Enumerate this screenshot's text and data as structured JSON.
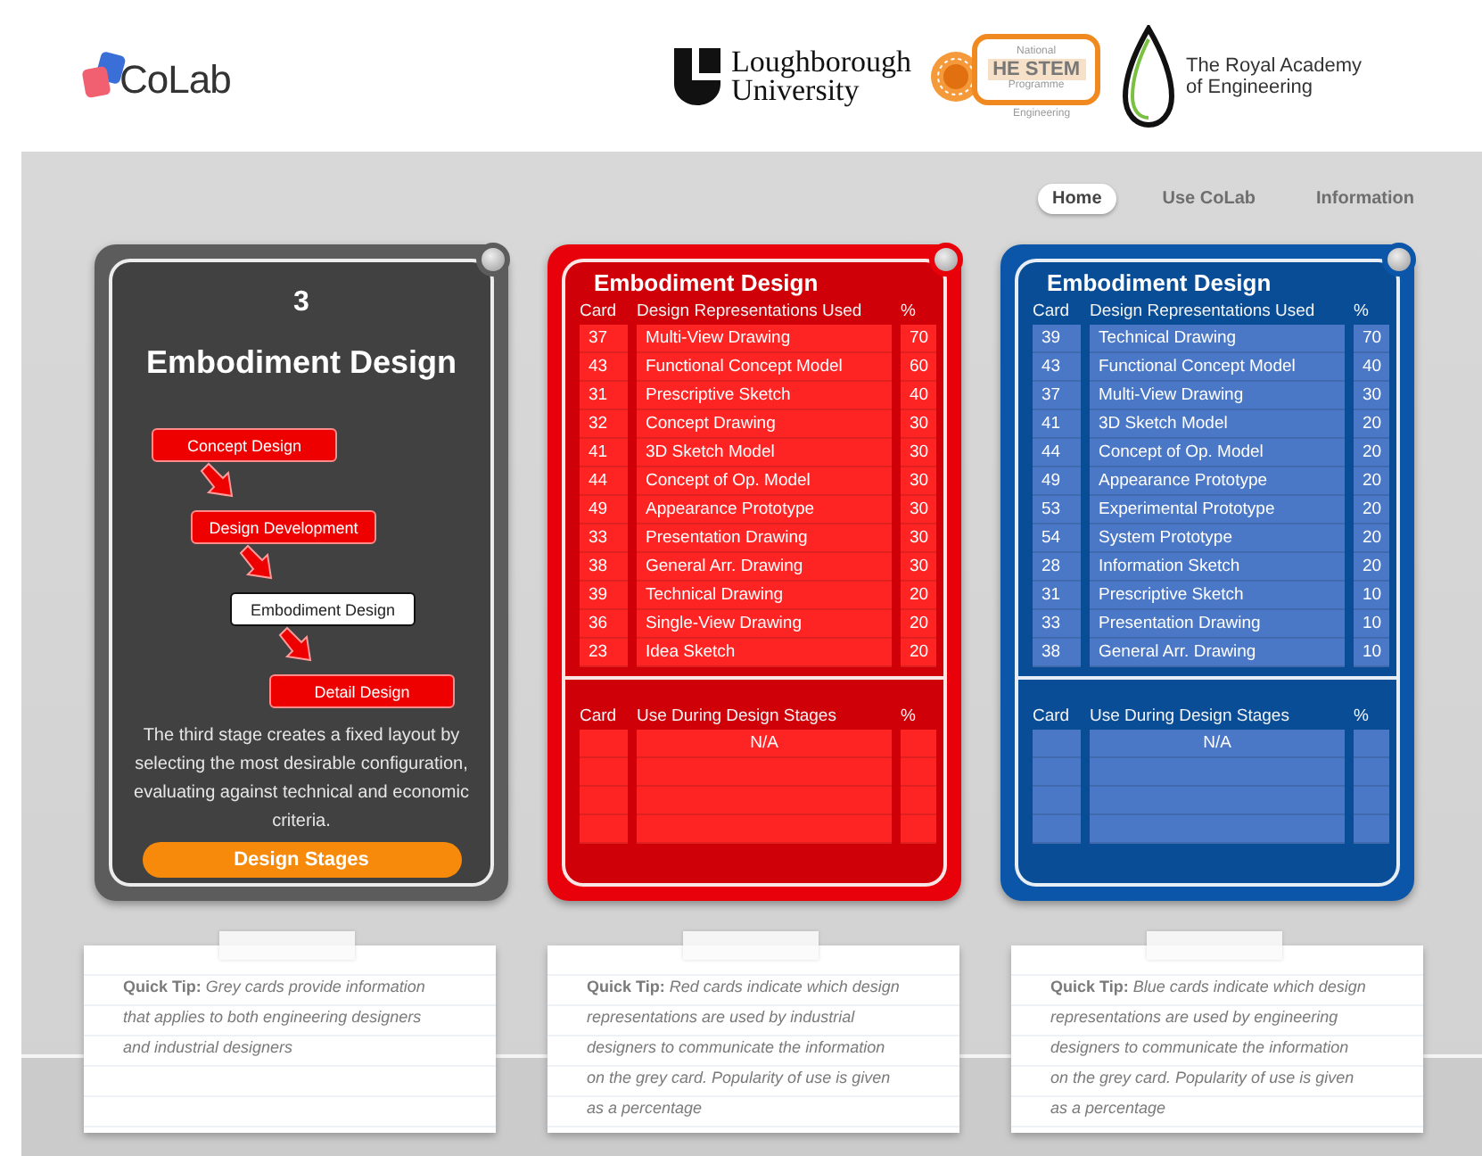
{
  "header": {
    "logo": "CoLab",
    "loughborough": {
      "line_1": "Loughborough",
      "line_2": "University"
    },
    "he_stem": {
      "top": "National",
      "name": "HE STEM",
      "sub": "Programme",
      "bottom": "Engineering"
    },
    "royal_academy": {
      "line_1": "The Royal Academy",
      "line_2": "of Engineering"
    }
  },
  "nav": [
    {
      "label": "Home",
      "selected": true
    },
    {
      "label": "Use CoLab",
      "selected": false
    },
    {
      "label": "Information",
      "selected": false
    }
  ],
  "stage_card": {
    "number": "3",
    "title": "Embodiment Design",
    "stages": [
      {
        "label": "Concept Design",
        "selected": false
      },
      {
        "label": "Design Development",
        "selected": false
      },
      {
        "label": "Embodiment Design",
        "selected": true
      },
      {
        "label": "Detail Design",
        "selected": false
      }
    ],
    "description": "The third stage creates a fixed layout by selecting the most desirable configuration, evaluating against technical and economic criteria.",
    "button": "Design Stages"
  },
  "representation_cards": [
    {
      "color": "#e8000a",
      "title": "Embodiment Design",
      "columns": [
        "Card",
        "Design Representations Used",
        "%"
      ],
      "rows": [
        [
          "37",
          "Multi-View Drawing",
          "70"
        ],
        [
          "43",
          "Functional Concept Model",
          "60"
        ],
        [
          "31",
          "Prescriptive Sketch",
          "40"
        ],
        [
          "32",
          "Concept Drawing",
          "30"
        ],
        [
          "41",
          "3D Sketch Model",
          "30"
        ],
        [
          "44",
          "Concept of Op. Model",
          "30"
        ],
        [
          "49",
          "Appearance Prototype",
          "30"
        ],
        [
          "33",
          "Presentation Drawing",
          "30"
        ],
        [
          "38",
          "General Arr. Drawing",
          "30"
        ],
        [
          "39",
          "Technical Drawing",
          "20"
        ],
        [
          "36",
          "Single-View Drawing",
          "20"
        ],
        [
          "23",
          "Idea Sketch",
          "20"
        ]
      ],
      "stage_columns": [
        "Card",
        "Use During Design Stages",
        "%"
      ],
      "stage_rows": [
        {
          "stage": "N/A"
        }
      ]
    },
    {
      "color": "#0b56a8",
      "title": "Embodiment Design",
      "columns": [
        "Card",
        "Design Representations Used",
        "%"
      ],
      "rows": [
        [
          "39",
          "Technical Drawing",
          "70"
        ],
        [
          "43",
          "Functional Concept Model",
          "40"
        ],
        [
          "37",
          "Multi-View Drawing",
          "30"
        ],
        [
          "41",
          "3D Sketch Model",
          "20"
        ],
        [
          "44",
          "Concept of Op. Model",
          "20"
        ],
        [
          "49",
          "Appearance Prototype",
          "20"
        ],
        [
          "53",
          "Experimental Prototype",
          "20"
        ],
        [
          "54",
          "System Prototype",
          "20"
        ],
        [
          "28",
          "Information Sketch",
          "20"
        ],
        [
          "31",
          "Prescriptive Sketch",
          "10"
        ],
        [
          "33",
          "Presentation Drawing",
          "10"
        ],
        [
          "38",
          "General Arr. Drawing",
          "10"
        ]
      ],
      "stage_columns": [
        "Card",
        "Use During Design Stages",
        "%"
      ],
      "stage_rows": [
        {
          "stage": "N/A"
        }
      ]
    }
  ],
  "tips": [
    "**Quick Tip:** *Grey cards provide information that applies to both engineering designers and industrial designers*",
    "**Quick Tip:** *Red cards indicate which design representations are used by industrial designers to communicate the information on the grey card. Popularity of use is given as a percentage*",
    "**Quick Tip:** *Blue cards indicate which design representations are used by engineering designers to communicate the information on the grey card. Popularity of use is given as a percentage*"
  ]
}
